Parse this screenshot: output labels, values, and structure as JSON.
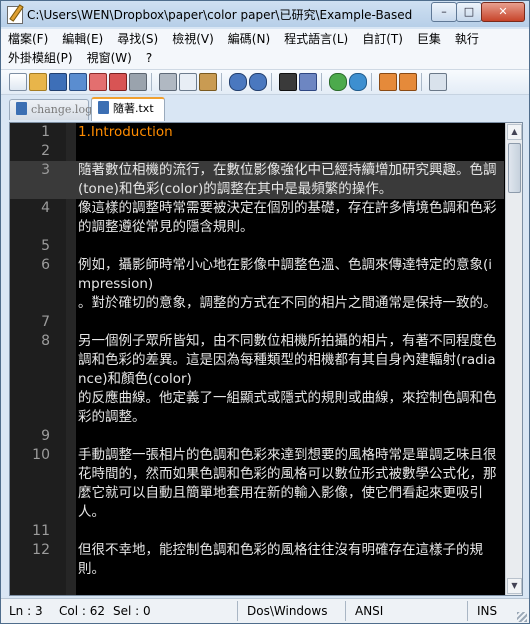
{
  "window": {
    "title": "C:\\Users\\WEN\\Dropbox\\paper\\color paper\\已研究\\Example-Based Picture Re...",
    "min": "–",
    "max": "□",
    "close": "✕"
  },
  "menu": {
    "row1": [
      "檔案(F)",
      "編輯(E)",
      "尋找(S)",
      "檢視(V)",
      "編碼(N)",
      "程式語言(L)",
      "自訂(T)",
      "巨集",
      "執行"
    ],
    "row2": [
      "外掛模組(P)",
      "視窗(W)",
      "?"
    ]
  },
  "toolbar_icons": [
    "new-file-icon",
    "open-file-icon",
    "save-icon",
    "save-all-icon",
    "close-icon",
    "close-all-icon",
    "print-icon",
    "cut-icon",
    "copy-icon",
    "paste-icon",
    "undo-icon",
    "redo-icon",
    "find-icon",
    "replace-icon",
    "zoom-in-icon",
    "zoom-out-icon",
    "sync-vertical-icon",
    "sync-horizontal-icon",
    "word-wrap-icon"
  ],
  "tabs": [
    {
      "label": "change.log",
      "active": false
    },
    {
      "label": "隨著.txt",
      "active": true
    }
  ],
  "editor": {
    "lines": [
      {
        "num": "1",
        "text": "1.Introduction",
        "orange": true,
        "highlight": false
      },
      {
        "num": "2",
        "text": "",
        "orange": false,
        "highlight": false
      },
      {
        "num": "3",
        "text": "隨著數位相機的流行，在數位影像強化中已經持續增加研究興趣。色調(tone)和色彩(color)的調整在其中是最頻繁的操作。",
        "orange": false,
        "highlight": true
      },
      {
        "num": "4",
        "text": "像這樣的調整時常需要被決定在個別的基礎，存在許多情境色調和色彩的調整遵從常見的隱含規則。",
        "orange": false,
        "highlight": false
      },
      {
        "num": "5",
        "text": "",
        "orange": false,
        "highlight": false
      },
      {
        "num": "6",
        "text": "例如，攝影師時常小心地在影像中調整色溫、色調來傳達特定的意象(impression)\n。對於確切的意象，調整的方式在不同的相片之間通常是保持一致的。",
        "orange": false,
        "highlight": false
      },
      {
        "num": "7",
        "text": "",
        "orange": false,
        "highlight": false
      },
      {
        "num": "8",
        "text": "另一個例子眾所皆知，由不同數位相機所拍攝的相片，有著不同程度色調和色彩的差異。這是因為每種類型的相機都有其自身內建輻射(radiance)和顏色(color)\n的反應曲線。他定義了一組顯式或隱式的規則或曲線，來控制色調和色彩的調整。",
        "orange": false,
        "highlight": false
      },
      {
        "num": "9",
        "text": "",
        "orange": false,
        "highlight": false
      },
      {
        "num": "10",
        "text": "手動調整一張相片的色調和色彩來達到想要的風格時常是單調乏味且很花時間的，然而如果色調和色彩的風格可以數位形式被數學公式化，那麼它就可以自動且簡單地套用在新的輸入影像，使它們看起來更吸引人。",
        "orange": false,
        "highlight": false
      },
      {
        "num": "11",
        "text": "",
        "orange": false,
        "highlight": false
      },
      {
        "num": "12",
        "text": "但很不幸地，能控制色調和色彩的風格往往沒有明確存在這樣子的規則。",
        "orange": false,
        "highlight": false
      }
    ]
  },
  "status": {
    "ln": "Ln : 3",
    "col": "Col : 62",
    "sel": "Sel : 0",
    "eol": "Dos\\Windows",
    "enc": "ANSI",
    "mode": "INS"
  }
}
